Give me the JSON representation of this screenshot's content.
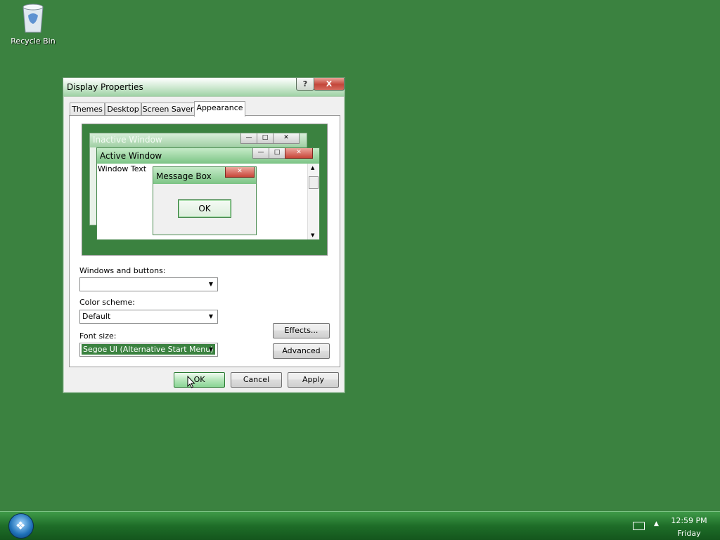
{
  "desktop": {
    "background_color": "#3b8240",
    "icons": [
      {
        "label": "Recycle Bin",
        "icon": "recycle-bin-icon"
      }
    ]
  },
  "dialog": {
    "title": "Display Properties",
    "help_label": "?",
    "close_label": "X",
    "tabs": [
      {
        "label": "Themes",
        "active": false
      },
      {
        "label": "Desktop",
        "active": false
      },
      {
        "label": "Screen Saver",
        "active": false
      },
      {
        "label": "Appearance",
        "active": true
      }
    ],
    "preview": {
      "inactive_title": "Inactive Window",
      "active_title": "Active Window",
      "window_text": "Window Text",
      "message_box_title": "Message Box",
      "message_box_ok": "OK"
    },
    "form": {
      "windows_buttons_label": "Windows and buttons:",
      "windows_buttons_value": "",
      "color_scheme_label": "Color scheme:",
      "color_scheme_value": "Default",
      "font_size_label": "Font size:",
      "font_size_value": "Segoe UI (Alternative Start Menu)",
      "effects_label": "Effects...",
      "advanced_label": "Advanced"
    },
    "buttons": {
      "ok": "OK",
      "cancel": "Cancel",
      "apply": "Apply"
    }
  },
  "taskbar": {
    "time": "12:59 PM",
    "day": "Friday"
  }
}
